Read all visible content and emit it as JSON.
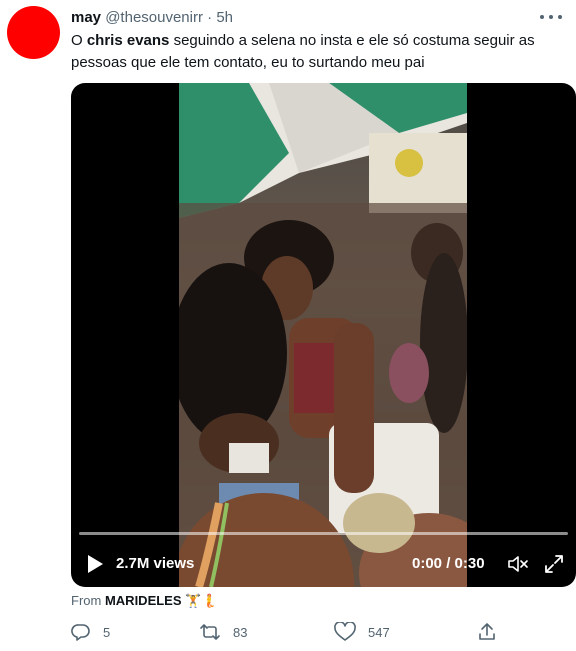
{
  "tweet": {
    "display_name": "may",
    "handle": "@thesouvenirr",
    "separator": "·",
    "time": "5h",
    "text_before": "O ",
    "text_bold": "chris evans",
    "text_after": " seguindo a selena no insta e ele só costuma seguir as pessoas que ele tem contato, eu to surtando meu pai"
  },
  "icons": {
    "more": "more-icon",
    "play": "play-icon",
    "volume": "volume-icon",
    "fullscreen": "fullscreen-icon",
    "reply": "reply-icon",
    "retweet": "retweet-icon",
    "like": "heart-icon",
    "share": "share-icon"
  },
  "video": {
    "views": "2.7M views",
    "time": "0:00 / 0:30",
    "progress": 0
  },
  "source": {
    "prefix": "From",
    "name": "MARIDELES",
    "emoji": "🏋️🧜"
  },
  "actions": {
    "reply_count": "5",
    "retweet_count": "83",
    "like_count": "547"
  },
  "colors": {
    "avatar": "#ff0000",
    "text": "#0f1419",
    "secondary": "#536471"
  }
}
